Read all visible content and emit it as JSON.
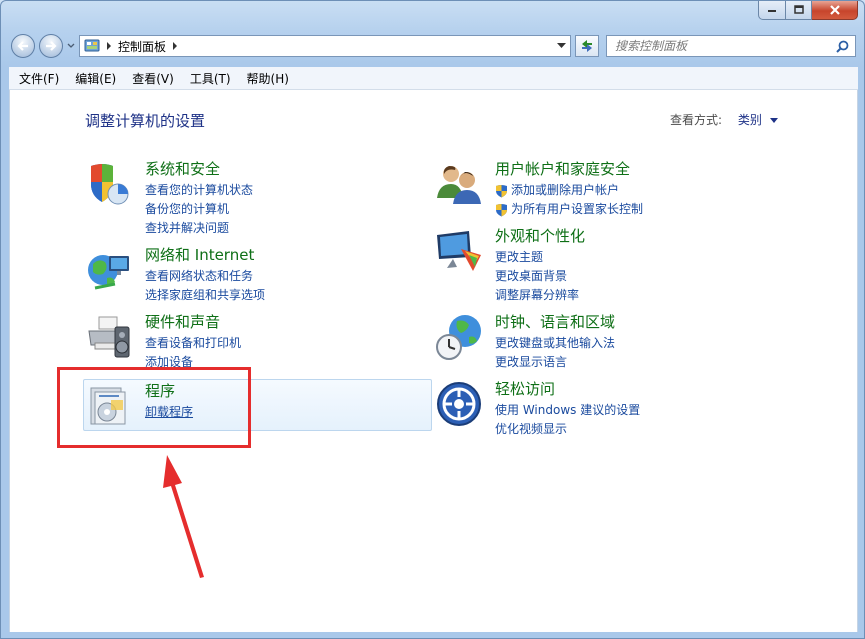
{
  "address": {
    "crumb": "控制面板"
  },
  "search": {
    "placeholder": "搜索控制面板"
  },
  "menu": [
    "文件(F)",
    "编辑(E)",
    "查看(V)",
    "工具(T)",
    "帮助(H)"
  ],
  "page": {
    "title": "调整计算机的设置",
    "view_by_label": "查看方式:",
    "view_by_value": "类别"
  },
  "categories": [
    {
      "title": "系统和安全",
      "links": [
        "查看您的计算机状态",
        "备份您的计算机",
        "查找并解决问题"
      ]
    },
    {
      "title": "网络和 Internet",
      "links": [
        "查看网络状态和任务",
        "选择家庭组和共享选项"
      ]
    },
    {
      "title": "硬件和声音",
      "links": [
        "查看设备和打印机",
        "添加设备"
      ]
    },
    {
      "title": "程序",
      "links": [
        "卸载程序"
      ]
    },
    {
      "title": "用户帐户和家庭安全",
      "links": [
        "添加或删除用户帐户",
        "为所有用户设置家长控制"
      ]
    },
    {
      "title": "外观和个性化",
      "links": [
        "更改主题",
        "更改桌面背景",
        "调整屏幕分辨率"
      ]
    },
    {
      "title": "时钟、语言和区域",
      "links": [
        "更改键盘或其他输入法",
        "更改显示语言"
      ]
    },
    {
      "title": "轻松访问",
      "links": [
        "使用 Windows 建议的设置",
        "优化视频显示"
      ]
    }
  ],
  "colors": {
    "title_green": "#0e6f16",
    "link_blue": "#1a4a9e",
    "heading_blue": "#1e3287",
    "highlight_red": "#e52d2d"
  }
}
